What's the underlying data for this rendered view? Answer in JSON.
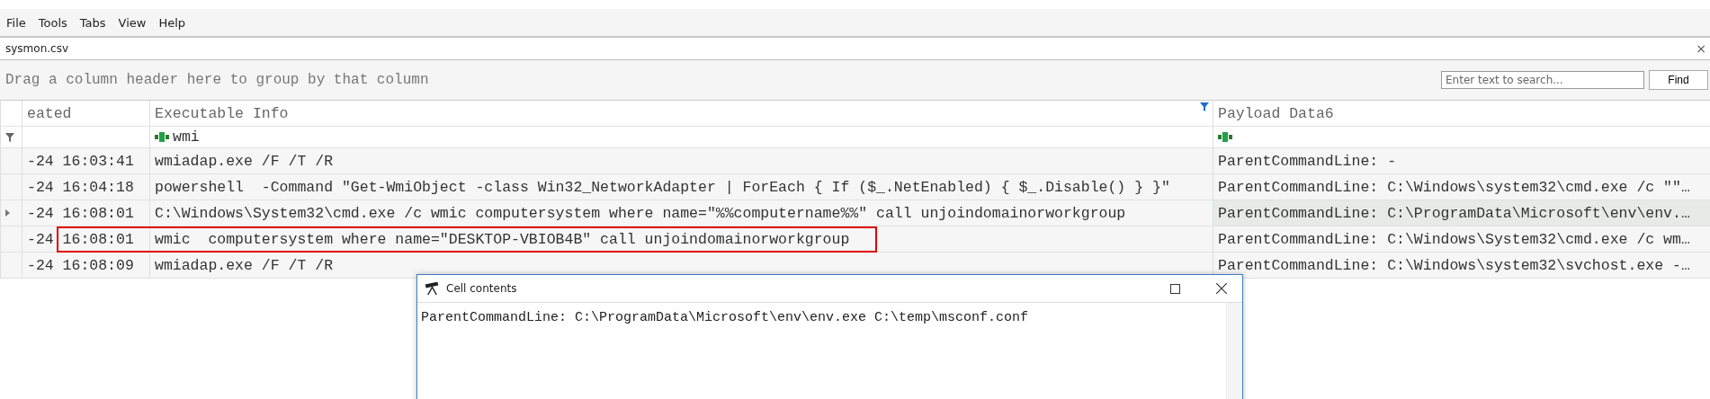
{
  "menu": [
    "File",
    "Tools",
    "Tabs",
    "View",
    "Help"
  ],
  "tab": {
    "label": "sysmon.csv",
    "close": "×"
  },
  "group_panel": {
    "hint": "Drag a column header here to group by that column",
    "search": {
      "placeholder": "Enter text to search..."
    },
    "find_button": "Find"
  },
  "columns": [
    {
      "label": "eated",
      "filtered": false
    },
    {
      "label": "Executable Info",
      "filtered": true
    },
    {
      "label": "Payload Data6",
      "filtered": false
    }
  ],
  "filter_row": {
    "executable_info": "wmi"
  },
  "rows": [
    {
      "created": "-24 16:03:41",
      "executable_info": "wmiadap.exe /F /T /R",
      "payload": "ParentCommandLine: -",
      "selected": false,
      "highlighted": false
    },
    {
      "created": "-24 16:04:18",
      "executable_info": "powershell  -Command \"Get-WmiObject -class Win32_NetworkAdapter | ForEach { If ($_.NetEnabled) { $_.Disable() } }\"",
      "payload": "ParentCommandLine: C:\\Windows\\system32\\cmd.exe /c \"\"…",
      "selected": false,
      "highlighted": false
    },
    {
      "created": "-24 16:08:01",
      "executable_info": "C:\\Windows\\System32\\cmd.exe /c wmic computersystem where name=\"%%computername%%\" call unjoindomainorworkgroup",
      "payload": "ParentCommandLine: C:\\ProgramData\\Microsoft\\env\\env.…",
      "selected": true,
      "highlighted": false
    },
    {
      "created": "-24 16:08:01",
      "executable_info": "wmic  computersystem where name=\"DESKTOP-VBIOB4B\" call unjoindomainorworkgroup",
      "payload": "ParentCommandLine: C:\\Windows\\System32\\cmd.exe /c wm…",
      "selected": false,
      "highlighted": true
    },
    {
      "created": "-24 16:08:09",
      "executable_info": "wmiadap.exe /F /T /R",
      "payload": "ParentCommandLine: C:\\Windows\\system32\\svchost.exe -…",
      "selected": false,
      "highlighted": false
    }
  ],
  "popup": {
    "title": "Cell contents",
    "text": "ParentCommandLine: C:\\ProgramData\\Microsoft\\env\\env.exe C:\\temp\\msconf.conf"
  }
}
